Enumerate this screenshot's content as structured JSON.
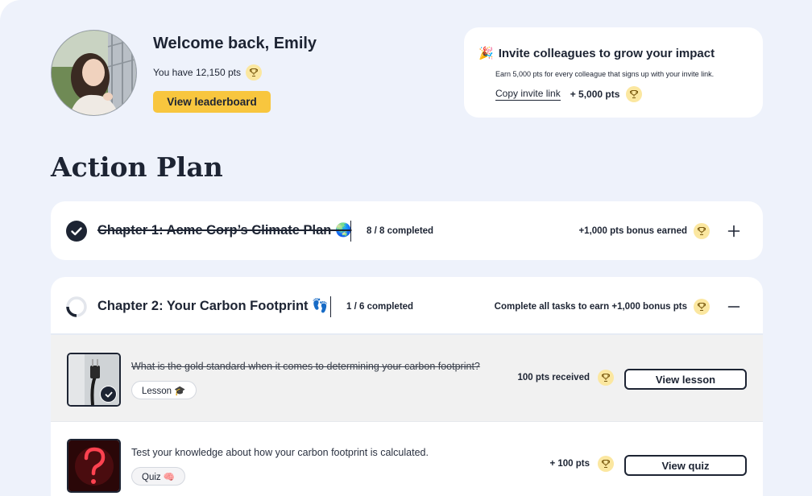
{
  "header": {
    "welcome": "Welcome back, Emily",
    "points_text": "You have 12,150 pts",
    "leaderboard_button": "View leaderboard"
  },
  "invite": {
    "emoji": "🎉",
    "title": "Invite colleagues to grow your impact",
    "description": "Earn 5,000 pts for every colleague that signs up with your invite link.",
    "copy_link": "Copy invite link",
    "points": "+ 5,000 pts"
  },
  "action_plan": {
    "title": "Action Plan",
    "chapters": [
      {
        "title": "Chapter 1: Acme Corp’s Climate Plan 🌏",
        "completed": "8 / 8 completed",
        "bonus": "+1,000 pts bonus earned",
        "state": "done",
        "expanded": false
      },
      {
        "title": "Chapter 2: Your Carbon Footprint 👣",
        "completed": "1 / 6 completed",
        "bonus": "Complete all tasks to earn +1,000 bonus pts",
        "state": "in-progress",
        "progress": 0.167,
        "expanded": true,
        "tasks": [
          {
            "text": "What is the gold standard when it comes to determining your carbon footprint?",
            "tag": "Lesson 🎓",
            "points": "100 pts received",
            "button": "View lesson",
            "done": true
          },
          {
            "text": "Test your knowledge about how your carbon footprint is calculated.",
            "tag": "Quiz 🧠",
            "points": "+ 100 pts",
            "button": "View quiz",
            "done": false
          }
        ]
      }
    ]
  },
  "colors": {
    "background": "#eef2fb",
    "accent_yellow": "#f8c63e",
    "trophy_bg": "#fbe7a0",
    "text_dark": "#1d2433"
  }
}
